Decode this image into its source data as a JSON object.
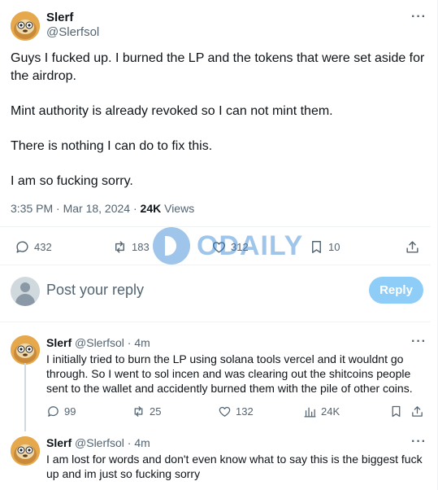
{
  "post": {
    "author_name": "Slerf",
    "author_handle": "@Slerfsol",
    "more": "···",
    "paragraphs": [
      "Guys I fucked up. I burned the LP and the tokens that were set aside for the airdrop.",
      "Mint authority is already revoked so I can not mint them.",
      "There is nothing I can do to fix this.",
      "I am so fucking sorry."
    ],
    "time_date": "3:35 PM · Mar 18, 2024 ·",
    "views_count": "24K",
    "views_label": "Views",
    "actions": {
      "replies": "432",
      "reposts": "183",
      "likes": "312",
      "bookmarks": "10"
    }
  },
  "watermark": {
    "text": "ODAILY"
  },
  "compose": {
    "placeholder": "Post your reply",
    "button": "Reply"
  },
  "replies": [
    {
      "name": "Slerf",
      "handle_time": "@Slerfsol · 4m",
      "more": "···",
      "text": "I initially tried to burn the LP using solana tools vercel and it wouldnt go through. So I went to sol incen and was clearing out the shitcoins people sent to the wallet and accidently burned them with the pile of other coins.",
      "actions": {
        "replies": "99",
        "reposts": "25",
        "likes": "132",
        "views": "24K"
      }
    },
    {
      "name": "Slerf",
      "handle_time": "@Slerfsol · 4m",
      "more": "···",
      "text": "I am lost for words and don't even know what to say this is the biggest fuck up and im just so fucking sorry"
    }
  ],
  "colors": {
    "text": "#0f1419",
    "secondary": "#536471",
    "reply_button": "#8ecdf7",
    "divider": "#eff3f4",
    "watermark": "#2f7fd3"
  }
}
